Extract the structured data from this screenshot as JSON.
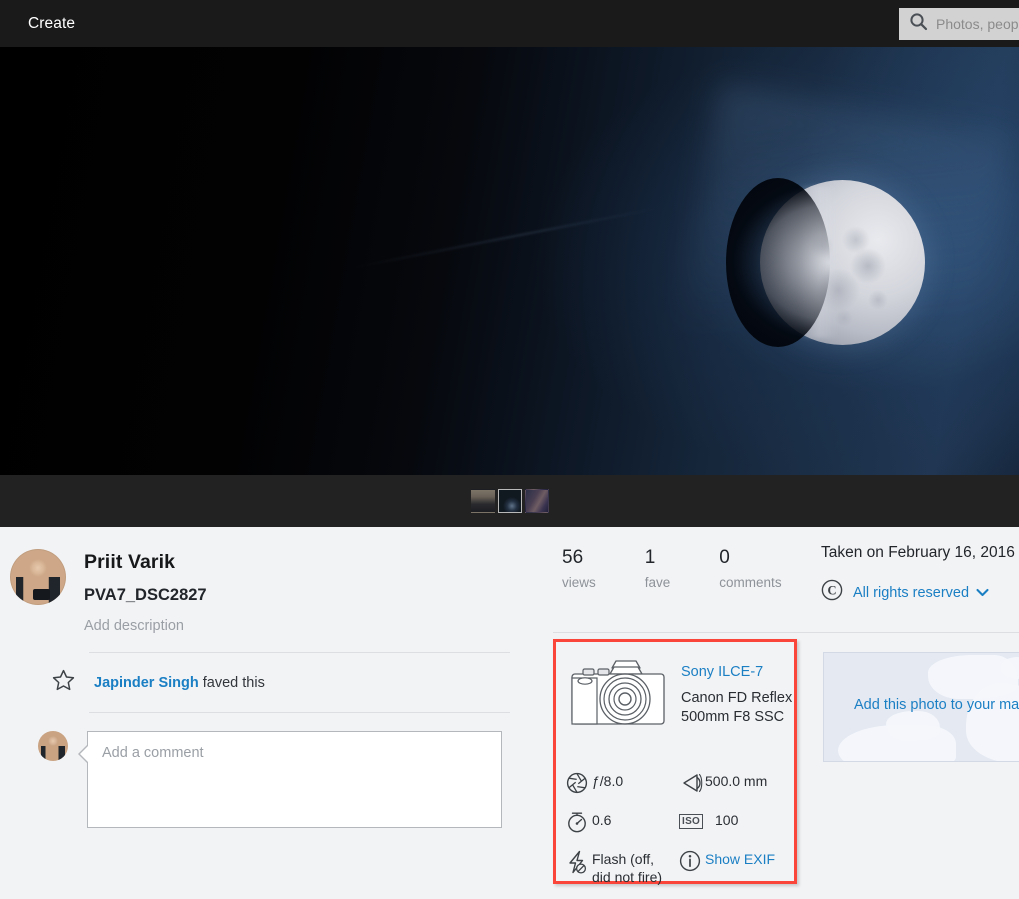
{
  "header": {
    "create_label": "Create",
    "search_placeholder": "Photos, people, or groups",
    "search_icon": "search-icon",
    "bg_color": "#1a1a1a"
  },
  "photo": {
    "subject": "waxing gibbous moon against dark blue night sky",
    "alt": "PVA7_DSC2827"
  },
  "thumbnails": [
    {
      "name": "thumbnail-1",
      "selected": false
    },
    {
      "name": "thumbnail-2",
      "selected": true
    },
    {
      "name": "thumbnail-3",
      "selected": false
    }
  ],
  "owner": {
    "name": "Priit Varik",
    "avatar_icon": "avatar",
    "photo_title": "PVA7_DSC2827",
    "add_description": "Add description"
  },
  "fave": {
    "star_icon": "star-icon",
    "user": "Japinder Singh",
    "suffix": " faved this"
  },
  "comment": {
    "avatar_icon": "avatar",
    "placeholder": "Add a comment",
    "value": ""
  },
  "stats": [
    {
      "number": "56",
      "label": "views"
    },
    {
      "number": "1",
      "label": "fave"
    },
    {
      "number": "0",
      "label": "comments"
    }
  ],
  "taken": {
    "text": "Taken on February 16, 2016",
    "license_icon": "copyright-icon",
    "license": "All rights reserved",
    "chevron_icon": "chevron-down-icon"
  },
  "exif": {
    "highlight_color": "#f9453a",
    "camera_icon": "camera-icon",
    "camera_model": "Sony ILCE-7",
    "lens_model": "Canon FD Reflex 500mm F8 SSC",
    "rows": [
      {
        "left": {
          "icon": "aperture-icon",
          "value": "ƒ/8.0"
        },
        "right": {
          "icon": "focal-length-icon",
          "value": "500.0 mm"
        }
      },
      {
        "left": {
          "icon": "shutter-speed-icon",
          "value": "0.6"
        },
        "right": {
          "icon": "iso-icon",
          "value": "100",
          "badge": "ISO"
        }
      },
      {
        "left": {
          "icon": "flash-off-icon",
          "value": "Flash (off, did not fire)"
        },
        "right": {
          "icon": "info-icon",
          "value": "Show EXIF",
          "link": true
        }
      }
    ]
  },
  "map": {
    "add_label": "Add this photo to your map",
    "bg_color": "#e4e9f2"
  },
  "colors": {
    "link": "#1b7fc4",
    "page_bg": "#f2f3f5",
    "strip_bg": "#222222"
  }
}
